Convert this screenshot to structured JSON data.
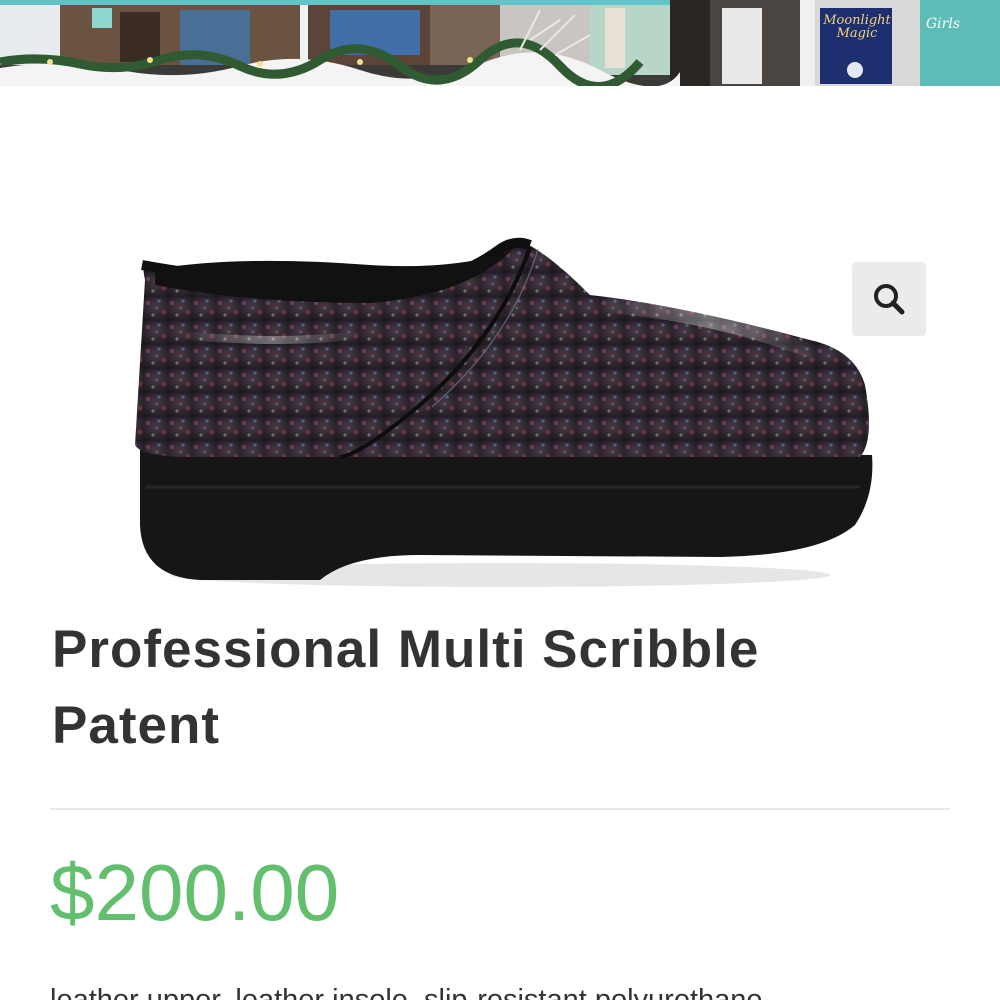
{
  "header": {
    "banner_image": "storefront-window-banner",
    "poster_title": "Moonlight Magic",
    "sign_title": "Girls"
  },
  "product": {
    "image": "multi-scribble-patent-clog",
    "title": "Professional Multi Scribble Patent",
    "price": "$200.00",
    "description": "leather upper, leather insole, slip-resistant polyurethane"
  },
  "controls": {
    "zoom_icon": "search-icon"
  },
  "colors": {
    "price": "#62bf6e",
    "title": "#333333",
    "banner_accent": "#63c4c8"
  }
}
